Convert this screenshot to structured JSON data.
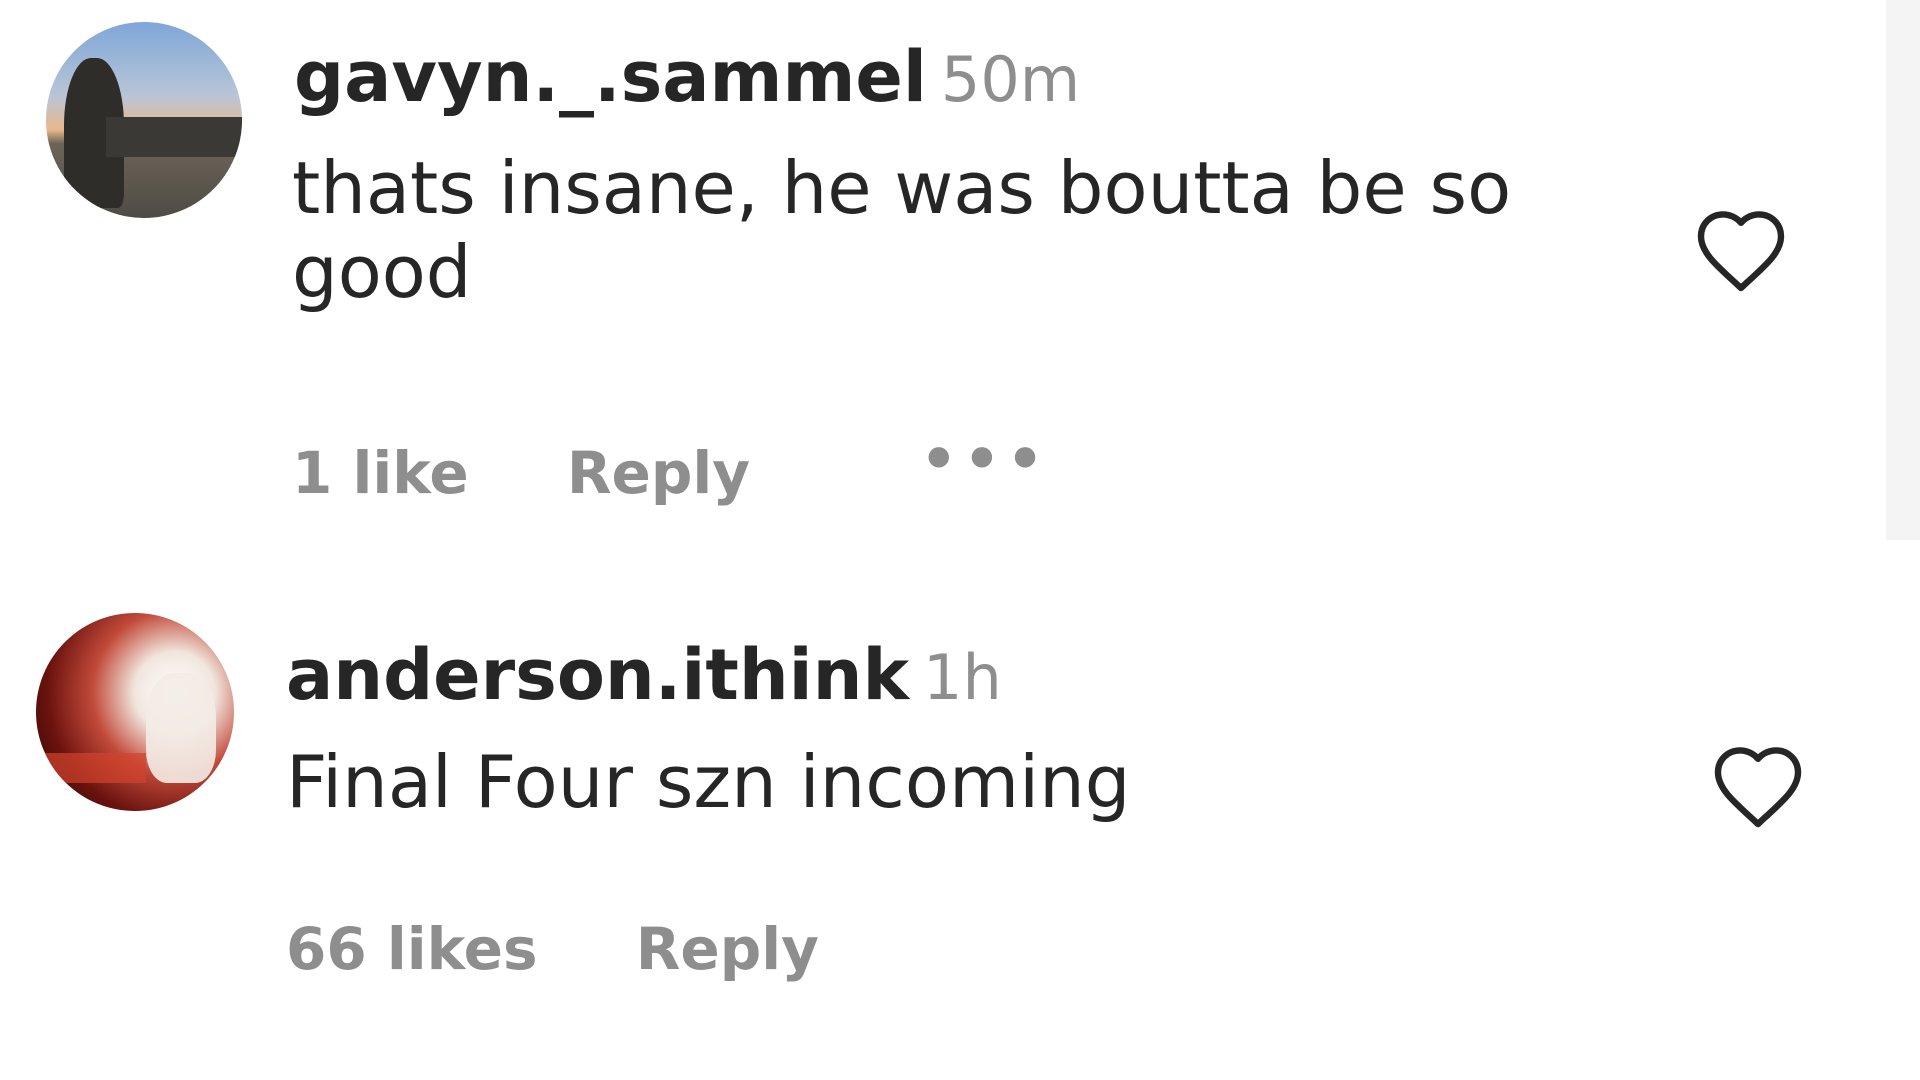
{
  "comments": [
    {
      "username": "gavyn._.sammel",
      "timestamp": "50m",
      "text": "thats insane, he was boutta be so good",
      "likes": "1 like",
      "reply_label": "Reply",
      "more_label": "•••"
    },
    {
      "username": "anderson.ithink",
      "timestamp": "1h",
      "text": "Final Four szn incoming",
      "likes": "66 likes",
      "reply_label": "Reply"
    }
  ],
  "icons": {
    "like": "heart-outline-icon",
    "more": "ellipsis-icon"
  },
  "colors": {
    "text_primary": "#262626",
    "text_secondary": "#8e8e8e",
    "background": "#ffffff"
  }
}
